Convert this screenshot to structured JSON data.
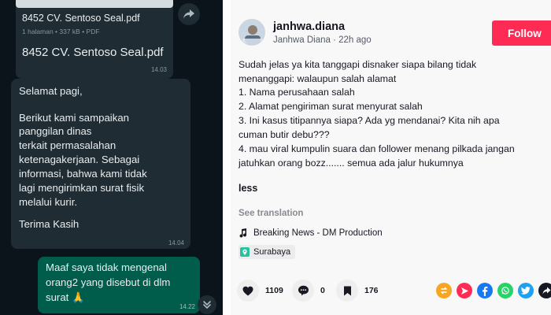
{
  "chat": {
    "document": {
      "filename": "8452 CV. Sentoso Seal.pdf",
      "meta": "1 halaman • 337 kB • PDF",
      "caption": "8452 CV. Sentoso Seal.pdf",
      "time": "14.03"
    },
    "incoming_message": {
      "lines": [
        "Selamat pagi,",
        "",
        "Berikut kami sampaikan",
        "panggilan dinas",
        "terkait permasalahan",
        "ketenagakerjaan. Sebagai",
        "informasi, bahwa kami tidak",
        "lagi mengirimkan surat fisik",
        "melalui kurir.",
        "",
        "Terima Kasih"
      ],
      "time": "14.04"
    },
    "outgoing_message": {
      "lines": [
        "Maaf saya tidak mengenal",
        "orang2 yang disebut di dlm",
        "surat 🙏"
      ],
      "time": "14.22"
    }
  },
  "post": {
    "username": "janhwa.diana",
    "display_name": "Janhwa Diana · 22h ago",
    "follow_label": "Follow",
    "caption_lines": [
      "Sudah jelas ya kita tanggapi disnaker siapa bilang tidak",
      "menanggapi: walaupun salah alamat",
      "1. Nama perusahaan salah",
      "2. Alamat pengiriman surat menyurat salah",
      "3. Ini kasus titipannya siapa? Ada yg mendanai? Kita nih apa",
      "cuman butir debu???",
      "4. mau viral kumpulin suara dan follower menang pilkada jangan",
      "jatuhkan orang bozz....... semua ada jalur hukumnya"
    ],
    "less_label": "less",
    "see_translation_label": "See translation",
    "music": "Breaking News - DM Production",
    "location": "Surabaya",
    "stats": {
      "likes": "1109",
      "comments": "0",
      "saves": "176"
    }
  },
  "colors": {
    "chat_background": "#0b141a",
    "incoming_bubble": "#1f2c33",
    "outgoing_bubble": "#005c4b",
    "follow_button": "#fe2c55",
    "location_pin": "#25c1a0",
    "share_repost": "#f5a623",
    "share_direct": "#fe2c55",
    "share_facebook": "#1877f2",
    "share_whatsapp": "#25d366",
    "share_twitter": "#1da1f2"
  },
  "icons": {
    "forward": "forward-arrow-icon",
    "scroll_down": "double-chevron-down-icon",
    "like": "heart-icon",
    "comment": "comment-icon",
    "save": "bookmark-icon",
    "music": "music-note-icon",
    "location": "location-pin-icon",
    "share": [
      "repost-icon",
      "send-icon",
      "facebook-icon",
      "whatsapp-icon",
      "twitter-icon"
    ]
  }
}
